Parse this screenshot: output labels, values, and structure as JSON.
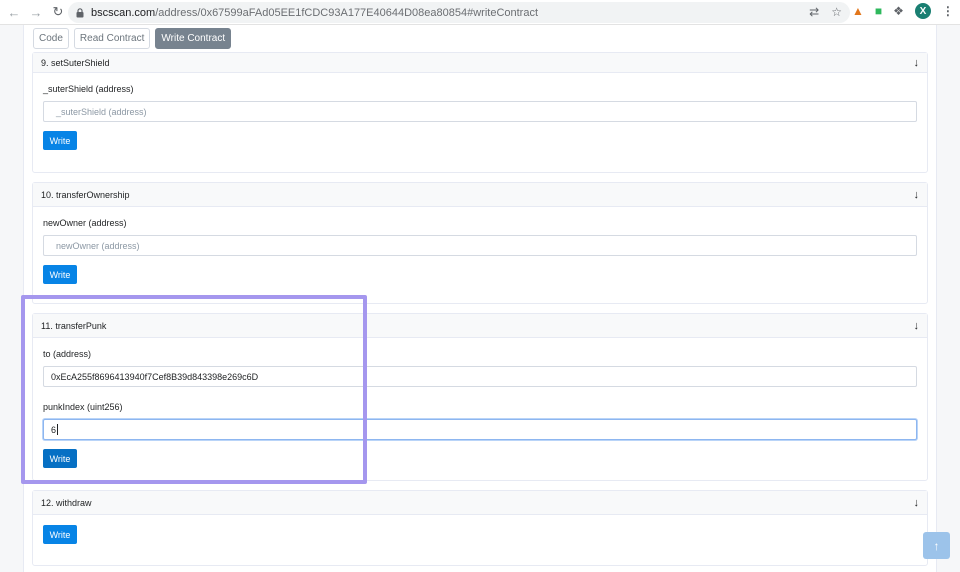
{
  "browser": {
    "url_host": "bscscan.com",
    "url_rest": "/address/0x67599aFAd05EE1fCDC93A177E40644D08ea80854#writeContract",
    "profile_initial": "X"
  },
  "tabs": [
    {
      "label": "Code"
    },
    {
      "label": "Read Contract"
    },
    {
      "label": "Write Contract"
    }
  ],
  "cards": {
    "c9": {
      "title": "9. setSuterShield",
      "fields": [
        {
          "label": "_suterShield (address)",
          "placeholder": "_suterShield (address)",
          "value": ""
        }
      ],
      "button": "Write"
    },
    "c10": {
      "title": "10. transferOwnership",
      "fields": [
        {
          "label": "newOwner (address)",
          "placeholder": "newOwner (address)",
          "value": ""
        }
      ],
      "button": "Write"
    },
    "c11": {
      "title": "11. transferPunk",
      "fields": [
        {
          "label": "to (address)",
          "value": "0xEcA255f8696413940f7Cef8B39d843398e269c6D"
        },
        {
          "label": "punkIndex (uint256)",
          "value": "6"
        }
      ],
      "button": "Write"
    },
    "c12": {
      "title": "12. withdraw",
      "button": "Write"
    }
  },
  "colors": {
    "write_button": "#0784e6",
    "active_tab": "#77838f",
    "highlight_outline": "#a597ee"
  }
}
